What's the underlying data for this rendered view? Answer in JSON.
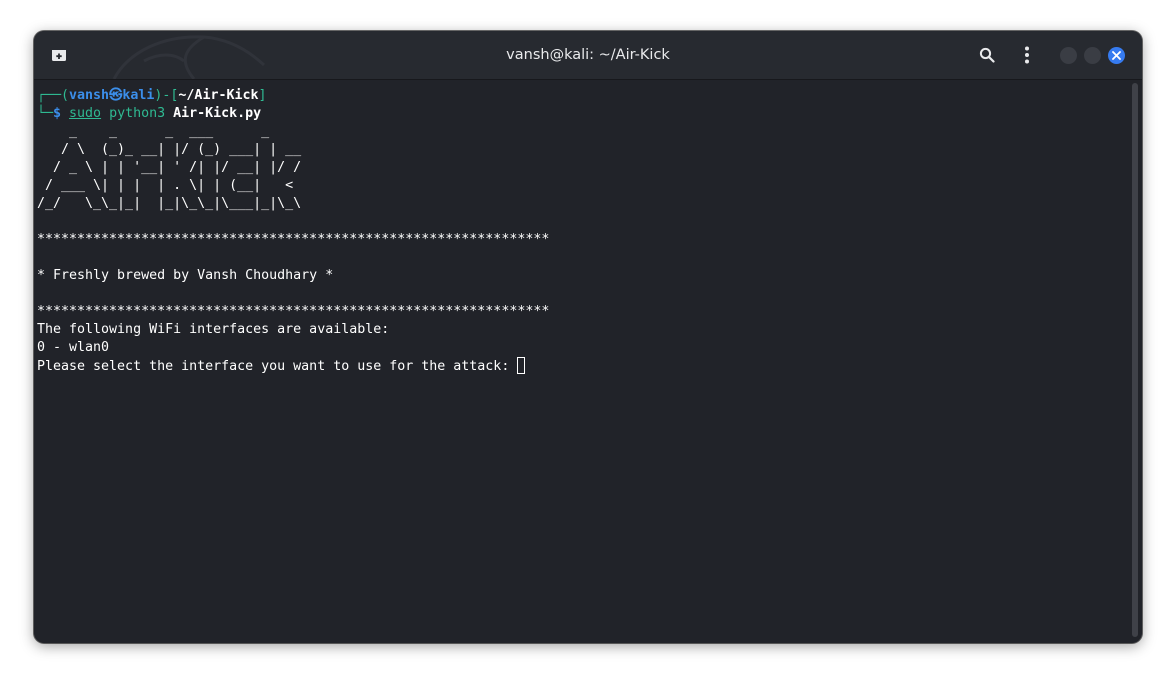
{
  "window": {
    "title": "vansh@kali: ~/Air-Kick"
  },
  "icons": {
    "new_tab": "new-tab-icon",
    "search": "search-icon",
    "menu": "kebab-menu-icon",
    "minimize": "minimize-icon",
    "maximize": "maximize-icon",
    "close": "close-icon"
  },
  "colors": {
    "background": "#212329",
    "titlebar": "#272a30",
    "prompt_green": "#2fba92",
    "prompt_blue": "#3b8eea",
    "close_button": "#367bf0"
  },
  "prompt": {
    "corner_top": "┌──(",
    "user": "vansh",
    "at": "㉿",
    "host": "kali",
    "mid": ")-[",
    "path": "~/Air-Kick",
    "end": "]",
    "corner_bottom": "└─",
    "dollar": "$ ",
    "sudo": "sudo",
    "command": " python3 ",
    "arg": "Air-Kick.py"
  },
  "output": {
    "banner": "    _    _      _  ___      _    \n   / \\  (_)_ __| |/ (_) ___| | __\n  / _ \\ | | '__| ' /| |/ __| |/ /\n / ___ \\| | |  | . \\| | (__|   < \n/_/   \\_\\_|_|  |_|\\_\\_|\\___|_|\\_\\",
    "stars": "****************************************************************",
    "credit": "* Freshly brewed by Vansh Choudhary *",
    "interfaces_header": "The following WiFi interfaces are available:",
    "interface_0": "0 - wlan0",
    "input_prompt": "Please select the interface you want to use for the attack: "
  }
}
